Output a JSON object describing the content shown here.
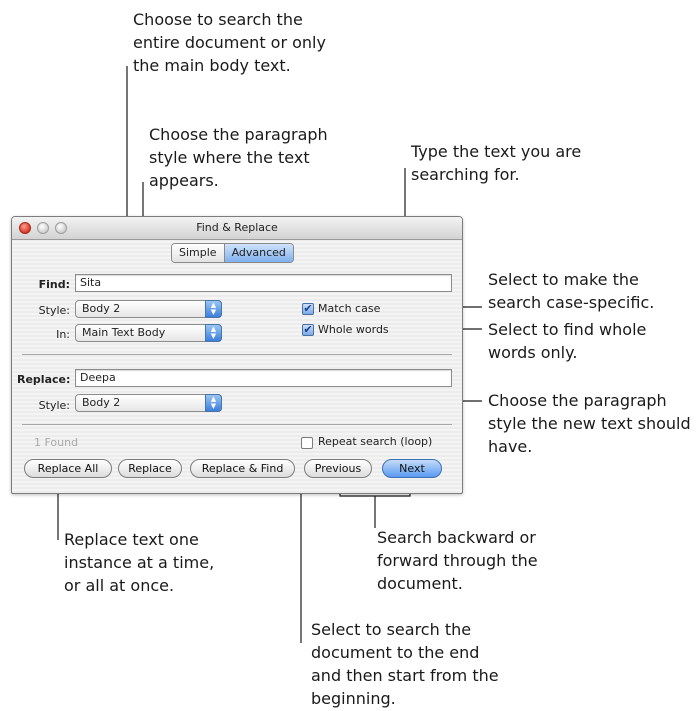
{
  "callouts": {
    "search_scope": "Choose to search the\nentire document or only\nthe main body text.",
    "para_style": "Choose the paragraph\nstyle where the text\nappears.",
    "type_text": "Type the text you are\nsearching for.",
    "match_case": "Select to make the\nsearch case-specific.",
    "whole_words": "Select to find whole\nwords only.",
    "replace_style": "Choose the paragraph\nstyle the new text should\nhave.",
    "replace_one": "Replace text one\ninstance at a time,\nor all at once.",
    "search_dir": "Search backward or\nforward through the\ndocument.",
    "loop": "Select to search the\ndocument to the end\nand then start from the\nbeginning."
  },
  "window": {
    "title": "Find & Replace",
    "tabs": {
      "simple": "Simple",
      "advanced": "Advanced",
      "selected": "Advanced"
    },
    "find": {
      "label": "Find:",
      "value": "Sita"
    },
    "find_style": {
      "label": "Style:",
      "value": "Body 2"
    },
    "in": {
      "label": "In:",
      "value": "Main Text Body"
    },
    "match_case": {
      "label": "Match case",
      "checked": true
    },
    "whole_words": {
      "label": "Whole words",
      "checked": true
    },
    "replace": {
      "label": "Replace:",
      "value": "Deepa"
    },
    "replace_style": {
      "label": "Style:",
      "value": "Body 2"
    },
    "found_status": "1 Found",
    "repeat_search": {
      "label": "Repeat search (loop)",
      "checked": false
    },
    "buttons": {
      "replace_all": "Replace All",
      "replace": "Replace",
      "replace_find": "Replace & Find",
      "previous": "Previous",
      "next": "Next"
    }
  },
  "icons": {
    "popup_arrow": "up-down-arrows",
    "checkmark": "✔"
  },
  "colors": {
    "accent_blue": "#5a9af0",
    "close_red": "#d63a2a",
    "disabled_text": "#a9a9a9"
  }
}
